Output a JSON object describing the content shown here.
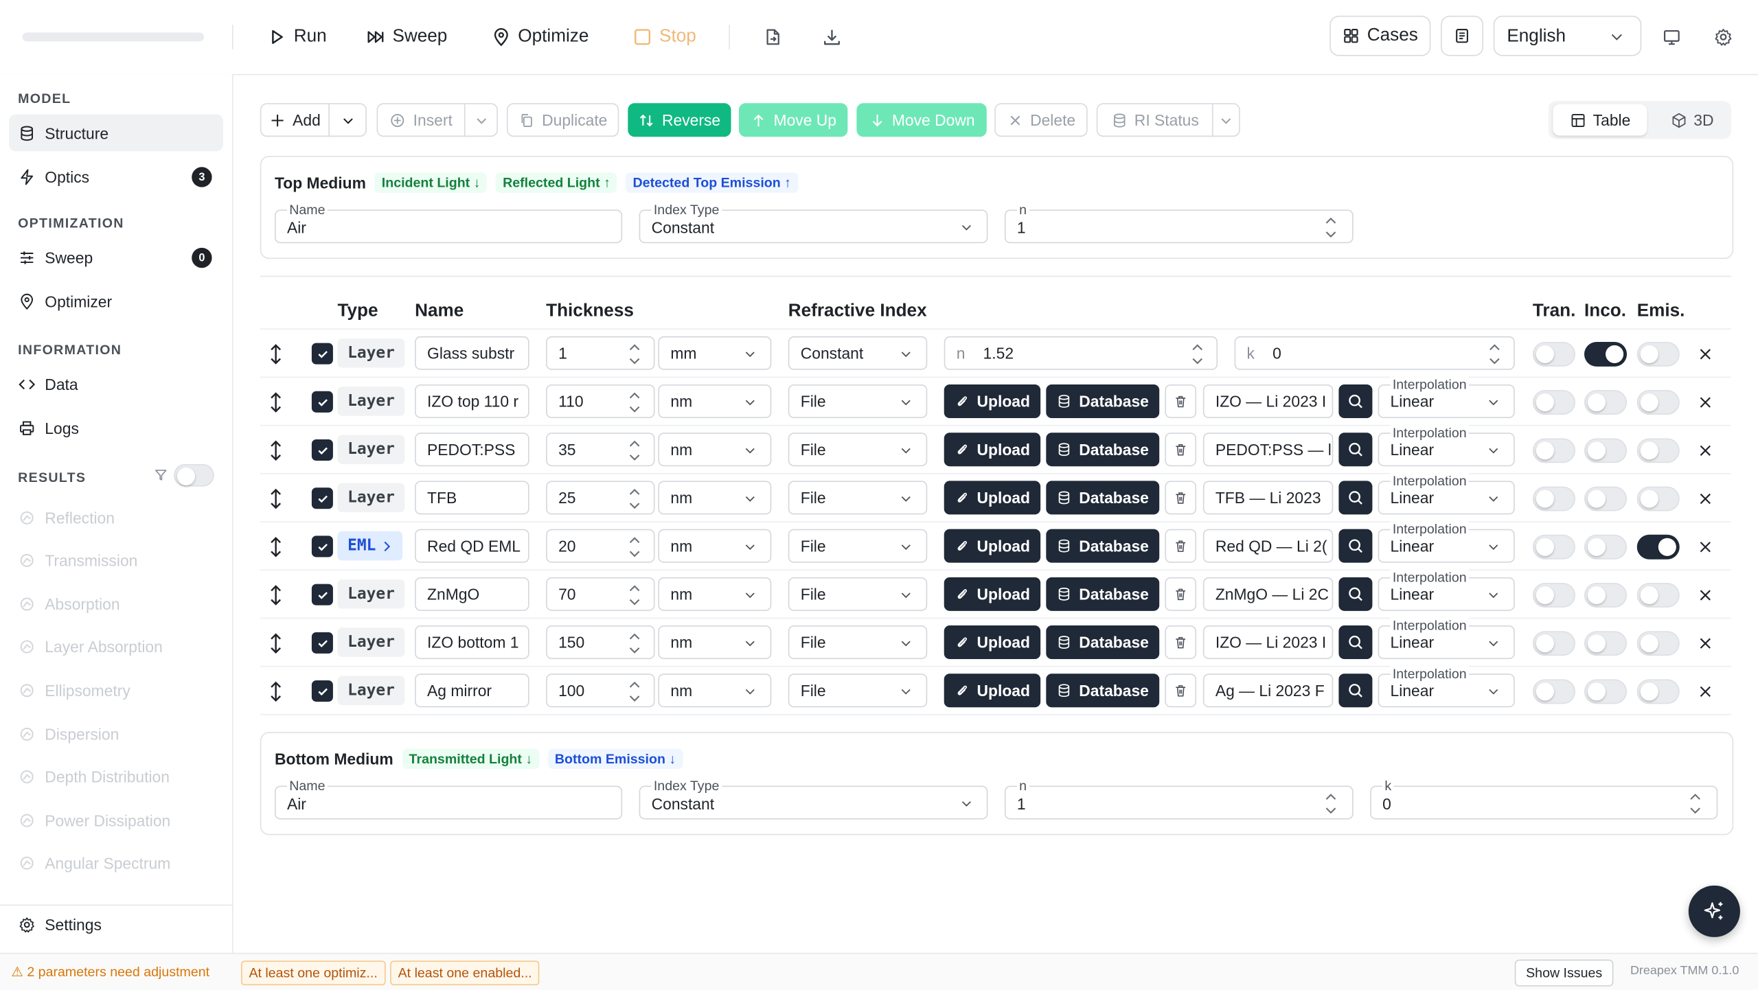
{
  "toolbar": {
    "run": "Run",
    "sweep": "Sweep",
    "optimize": "Optimize",
    "stop": "Stop",
    "cases": "Cases",
    "language": "English"
  },
  "sidebar": {
    "model_title": "MODEL",
    "structure": "Structure",
    "optics": "Optics",
    "optics_count": "3",
    "optimization_title": "OPTIMIZATION",
    "sweep": "Sweep",
    "sweep_count": "0",
    "optimizer": "Optimizer",
    "information_title": "INFORMATION",
    "data": "Data",
    "logs": "Logs",
    "results_title": "RESULTS",
    "results": [
      "Reflection",
      "Transmission",
      "Absorption",
      "Layer Absorption",
      "Ellipsometry",
      "Dispersion",
      "Depth Distribution",
      "Power Dissipation",
      "Angular Spectrum"
    ],
    "settings": "Settings"
  },
  "actions": {
    "add": "Add",
    "insert": "Insert",
    "duplicate": "Duplicate",
    "reverse": "Reverse",
    "move_up": "Move Up",
    "move_down": "Move Down",
    "delete": "Delete",
    "ri_status": "RI Status",
    "view_table": "Table",
    "view_3d": "3D"
  },
  "top_medium": {
    "title": "Top Medium",
    "tags": [
      "Incident Light ↓",
      "Reflected Light ↑",
      "Detected Top Emission ↑"
    ],
    "name_label": "Name",
    "name": "Air",
    "index_type_label": "Index Type",
    "index_type": "Constant",
    "n_label": "n",
    "n": "1"
  },
  "table": {
    "headers": {
      "type": "Type",
      "name": "Name",
      "thickness": "Thickness",
      "ri": "Refractive Index",
      "tran": "Tran.",
      "inco": "Inco.",
      "emis": "Emis."
    },
    "upload": "Upload",
    "database": "Database",
    "interp_label": "Interpolation",
    "first_row": {
      "n_label": "n",
      "n": "1.52",
      "k_label": "k",
      "k": "0"
    },
    "rows": [
      {
        "type": "Layer",
        "name": "Glass substr",
        "thickness": "1",
        "unit": "mm",
        "index": "Constant",
        "material": "",
        "interp": "",
        "tran": false,
        "inco": true,
        "emis": false
      },
      {
        "type": "Layer",
        "name": "IZO top 110 r",
        "thickness": "110",
        "unit": "nm",
        "index": "File",
        "material": "IZO — Li 2023 I",
        "interp": "Linear",
        "tran": false,
        "inco": false,
        "emis": false
      },
      {
        "type": "Layer",
        "name": "PEDOT:PSS",
        "thickness": "35",
        "unit": "nm",
        "index": "File",
        "material": "PEDOT:PSS — l",
        "interp": "Linear",
        "tran": false,
        "inco": false,
        "emis": false
      },
      {
        "type": "Layer",
        "name": "TFB",
        "thickness": "25",
        "unit": "nm",
        "index": "File",
        "material": "TFB — Li 2023",
        "interp": "Linear",
        "tran": false,
        "inco": false,
        "emis": false
      },
      {
        "type": "EML",
        "name": "Red QD EML",
        "thickness": "20",
        "unit": "nm",
        "index": "File",
        "material": "Red QD — Li 2(",
        "interp": "Linear",
        "tran": false,
        "inco": false,
        "emis": true
      },
      {
        "type": "Layer",
        "name": "ZnMgO",
        "thickness": "70",
        "unit": "nm",
        "index": "File",
        "material": "ZnMgO — Li 2C",
        "interp": "Linear",
        "tran": false,
        "inco": false,
        "emis": false
      },
      {
        "type": "Layer",
        "name": "IZO bottom 1",
        "thickness": "150",
        "unit": "nm",
        "index": "File",
        "material": "IZO — Li 2023 I",
        "interp": "Linear",
        "tran": false,
        "inco": false,
        "emis": false
      },
      {
        "type": "Layer",
        "name": "Ag mirror",
        "thickness": "100",
        "unit": "nm",
        "index": "File",
        "material": "Ag — Li 2023 F",
        "interp": "Linear",
        "tran": false,
        "inco": false,
        "emis": false
      }
    ]
  },
  "bottom_medium": {
    "title": "Bottom Medium",
    "tags": [
      "Transmitted Light ↓",
      "Bottom Emission ↓"
    ],
    "name_label": "Name",
    "name": "Air",
    "index_type_label": "Index Type",
    "index_type": "Constant",
    "n_label": "n",
    "n": "1",
    "k_label": "k",
    "k": "0"
  },
  "statusbar": {
    "warning": "⚠ 2 parameters need adjustment",
    "chips": [
      "At least one optimiz...",
      "At least one enabled..."
    ],
    "show_issues": "Show Issues",
    "version": "Dreapex TMM 0.1.0"
  },
  "colors": {
    "accent": "#10b981",
    "dark": "#1f2937",
    "warning": "#b45309"
  }
}
